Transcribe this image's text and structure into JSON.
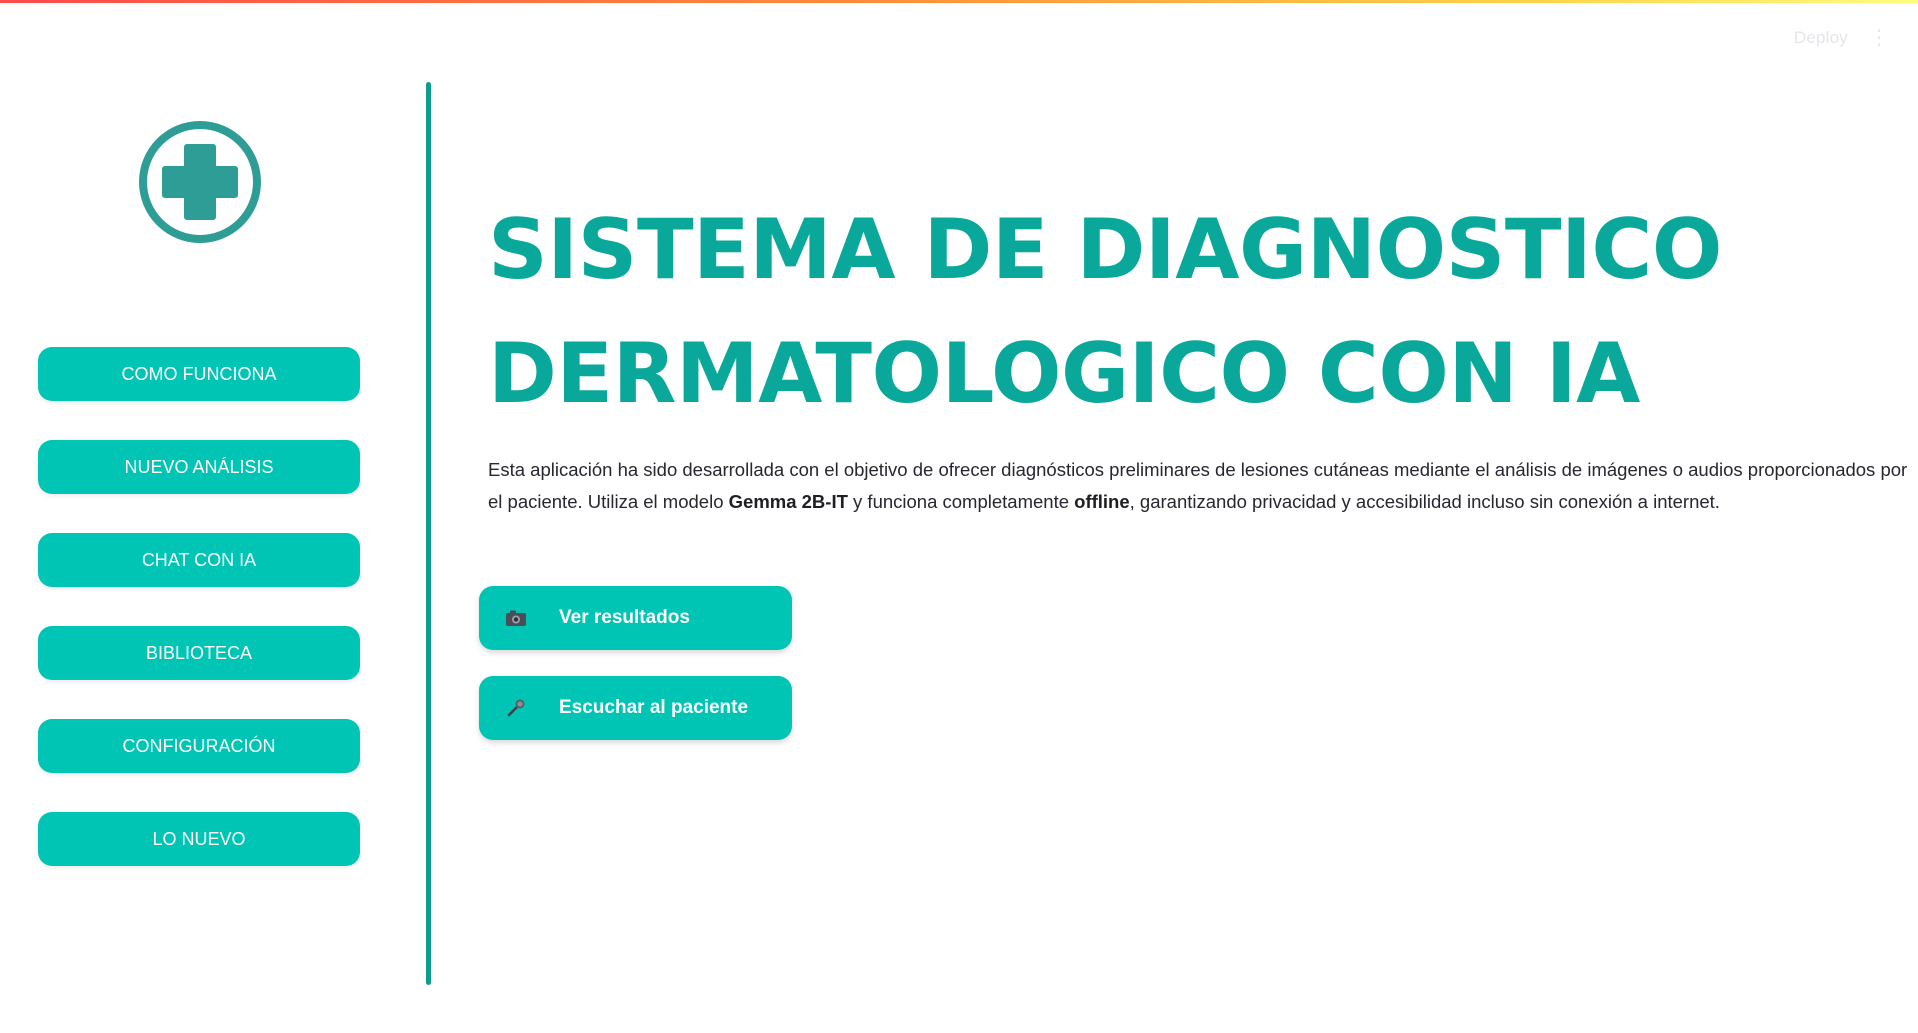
{
  "header": {
    "deploy_label": "Deploy",
    "menu_icon": "kebab-menu-icon"
  },
  "sidebar": {
    "logo_icon": "medical-cross-icon",
    "items": [
      {
        "label": "COMO FUNCIONA"
      },
      {
        "label": "NUEVO ANÁLISIS"
      },
      {
        "label": "CHAT CON IA"
      },
      {
        "label": "BIBLIOTECA"
      },
      {
        "label": "CONFIGURACIÓN"
      },
      {
        "label": "LO NUEVO"
      }
    ]
  },
  "main": {
    "title_line1": "SISTEMA DE DIAGNOSTICO",
    "title_line2": "DERMATOLOGICO CON IA",
    "description": {
      "part1": "Esta aplicación ha sido desarrollada con el objetivo de ofrecer diagnósticos preliminares de lesiones cutáneas mediante el análisis de imágenes o audios proporcionados por el paciente. Utiliza el modelo ",
      "model": "Gemma 2B-IT",
      "part2": " y funciona completamente ",
      "offline": "offline",
      "part3": ", garantizando privacidad y accesibilidad incluso sin conexión a internet."
    },
    "actions": [
      {
        "label": "Ver resultados",
        "icon": "camera-icon"
      },
      {
        "label": "Escuchar al paciente",
        "icon": "microphone-icon"
      }
    ]
  },
  "colors": {
    "accent": "#00c4b4",
    "title": "#0aa89a",
    "divider": "#0f9c8e",
    "logo": "#2e9d95"
  }
}
